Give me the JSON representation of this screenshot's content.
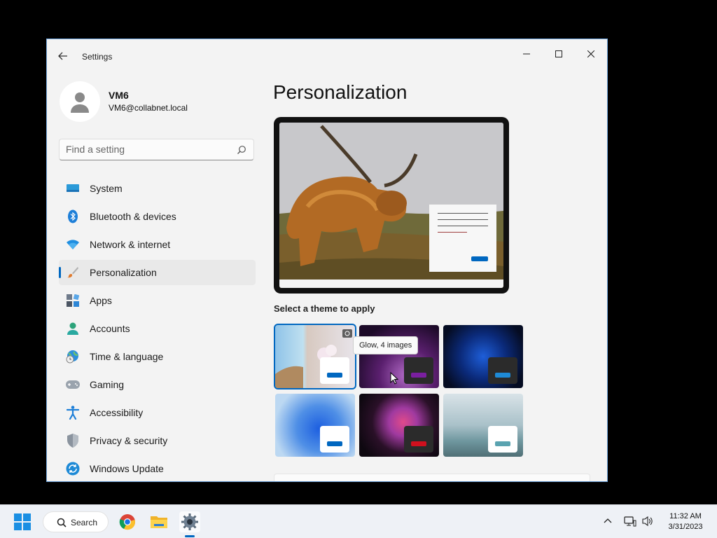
{
  "window": {
    "title": "Settings",
    "back_icon": "back-arrow-icon",
    "controls": [
      "minimize-icon",
      "maximize-icon",
      "close-icon"
    ]
  },
  "profile": {
    "name": "VM6",
    "email": "VM6@collabnet.local"
  },
  "search": {
    "placeholder": "Find a setting",
    "icon": "search-icon"
  },
  "sidebar": {
    "items": [
      {
        "label": "System",
        "icon": "system-icon"
      },
      {
        "label": "Bluetooth & devices",
        "icon": "bluetooth-icon"
      },
      {
        "label": "Network & internet",
        "icon": "wifi-icon"
      },
      {
        "label": "Personalization",
        "icon": "paintbrush-icon",
        "active": true
      },
      {
        "label": "Apps",
        "icon": "apps-icon"
      },
      {
        "label": "Accounts",
        "icon": "accounts-icon"
      },
      {
        "label": "Time & language",
        "icon": "globe-clock-icon"
      },
      {
        "label": "Gaming",
        "icon": "gamepad-icon"
      },
      {
        "label": "Accessibility",
        "icon": "accessibility-icon"
      },
      {
        "label": "Privacy & security",
        "icon": "shield-icon"
      },
      {
        "label": "Windows Update",
        "icon": "update-icon"
      }
    ]
  },
  "main": {
    "title": "Personalization",
    "themes_label": "Select a theme to apply",
    "tooltip": "Glow, 4 images",
    "accent_color": "#0067c0"
  },
  "taskbar": {
    "search_label": "Search",
    "time": "11:32 AM",
    "date": "3/31/2023"
  }
}
